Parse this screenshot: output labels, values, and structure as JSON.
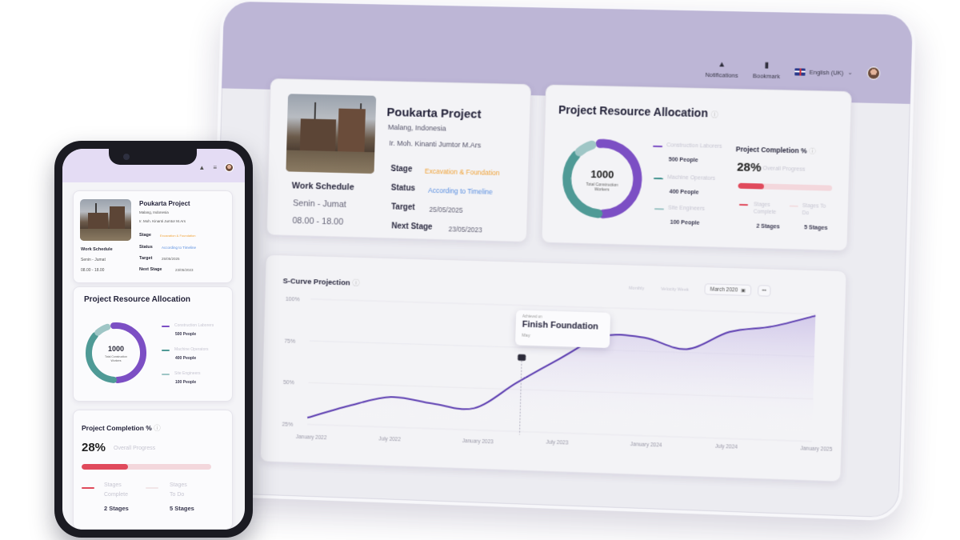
{
  "tablet": {
    "nav": {
      "notifications": "Notifications",
      "bookmark": "Bookmark",
      "language": "English (UK)"
    },
    "project": {
      "title": "Poukarta Project",
      "location": "Malang, Indonesia",
      "owner": "Ir. Moh. Kinanti Jumtor M.Ars",
      "work_schedule_label": "Work Schedule",
      "work_days": "Senin - Jumat",
      "work_hours": "08.00 - 18.00",
      "stage_label": "Stage",
      "stage_value": "Excavation & Foundation",
      "status_label": "Status",
      "status_value": "According to Timeline",
      "target_label": "Target",
      "target_value": "25/05/2025",
      "next_stage_label": "Next Stage",
      "next_stage_value": "23/05/2023"
    },
    "allocation": {
      "title": "Project Resource Allocation",
      "donut_total": "1000",
      "donut_caption_1": "Total Construction",
      "donut_caption_2": "Workers",
      "legend": [
        {
          "label": "Construction Laborers",
          "value": "500 People",
          "color": "#7c4fc4",
          "fraction": 0.5
        },
        {
          "label": "Machine Operators",
          "value": "400 People",
          "color": "#4f9a96",
          "fraction": 0.4
        },
        {
          "label": "Site Engineers",
          "value": "100 People",
          "color": "#9fc6c6",
          "fraction": 0.1
        }
      ],
      "completion_title": "Project Completion %",
      "completion_value": "28%",
      "completion_fraction": 0.28,
      "completion_caption": "Overall Progress",
      "stages_complete_label": "Stages Complete",
      "stages_complete_value": "2 Stages",
      "stages_todo_label": "Stages To Do",
      "stages_todo_value": "5 Stages"
    },
    "curve": {
      "title": "S-Curve Projection",
      "filter_label": "Monthly",
      "range_label": "Velocity Week",
      "date_button": "March 2020",
      "more": "•••",
      "tooltip_small": "Achieved on",
      "tooltip_title": "Finish Foundation",
      "tooltip_sub": "May"
    }
  },
  "phone": {
    "project_title": "Poukarta Project",
    "location": "Malang, Indonesia",
    "owner": "Ir. Moh. Kinanti Jumtor M.Ars",
    "stage_label": "Stage",
    "stage_value": "Excavation & Foundation",
    "work_schedule_label": "Work Schedule",
    "status_label": "Status",
    "status_value": "According to Timeline",
    "work_days": "Senin - Jumat",
    "target_label": "Target",
    "target_value": "25/05/2025",
    "work_hours": "08.00 - 18.00",
    "next_stage_label": "Next Stage",
    "next_stage_value": "23/05/2023",
    "allocation_title": "Project Resource Allocation",
    "donut_total": "1000",
    "donut_caption_1": "Total Construction",
    "donut_caption_2": "Workers",
    "legend": [
      {
        "label": "Construction Laborers",
        "value": "500 People"
      },
      {
        "label": "Machine Operators",
        "value": "400 People"
      },
      {
        "label": "Site Engineers",
        "value": "100 People"
      }
    ],
    "completion_title": "Project Completion %",
    "completion_value": "28%",
    "completion_caption": "Overall Progress",
    "stages_complete_label_1": "Stages",
    "stages_complete_label_2": "Complete",
    "stages_complete_value": "2 Stages",
    "stages_todo_label_1": "Stages",
    "stages_todo_label_2": "To Do",
    "stages_todo_value": "5 Stages"
  },
  "chart_data": {
    "type": "area",
    "title": "S-Curve Projection",
    "xlabel": "",
    "ylabel": "",
    "y_ticks": [
      "25%",
      "50%",
      "75%",
      "100%"
    ],
    "x_ticks": [
      "January 2022",
      "July 2022",
      "January 2023",
      "July 2023",
      "January 2024",
      "July 2024",
      "January 2025"
    ],
    "ylim": [
      25,
      100
    ],
    "series": [
      {
        "x": [
          0,
          0.5,
          1,
          1.5,
          2,
          2.5,
          3,
          3.5,
          4,
          4.5,
          5,
          5.5,
          6
        ],
        "values": [
          29,
          37,
          43,
          40,
          38,
          54,
          69,
          83,
          83,
          77,
          88,
          92,
          99
        ],
        "color": "#5b3cb0"
      }
    ],
    "annotation": {
      "x": 2.55,
      "y": 69,
      "label": "Finish Foundation"
    }
  }
}
